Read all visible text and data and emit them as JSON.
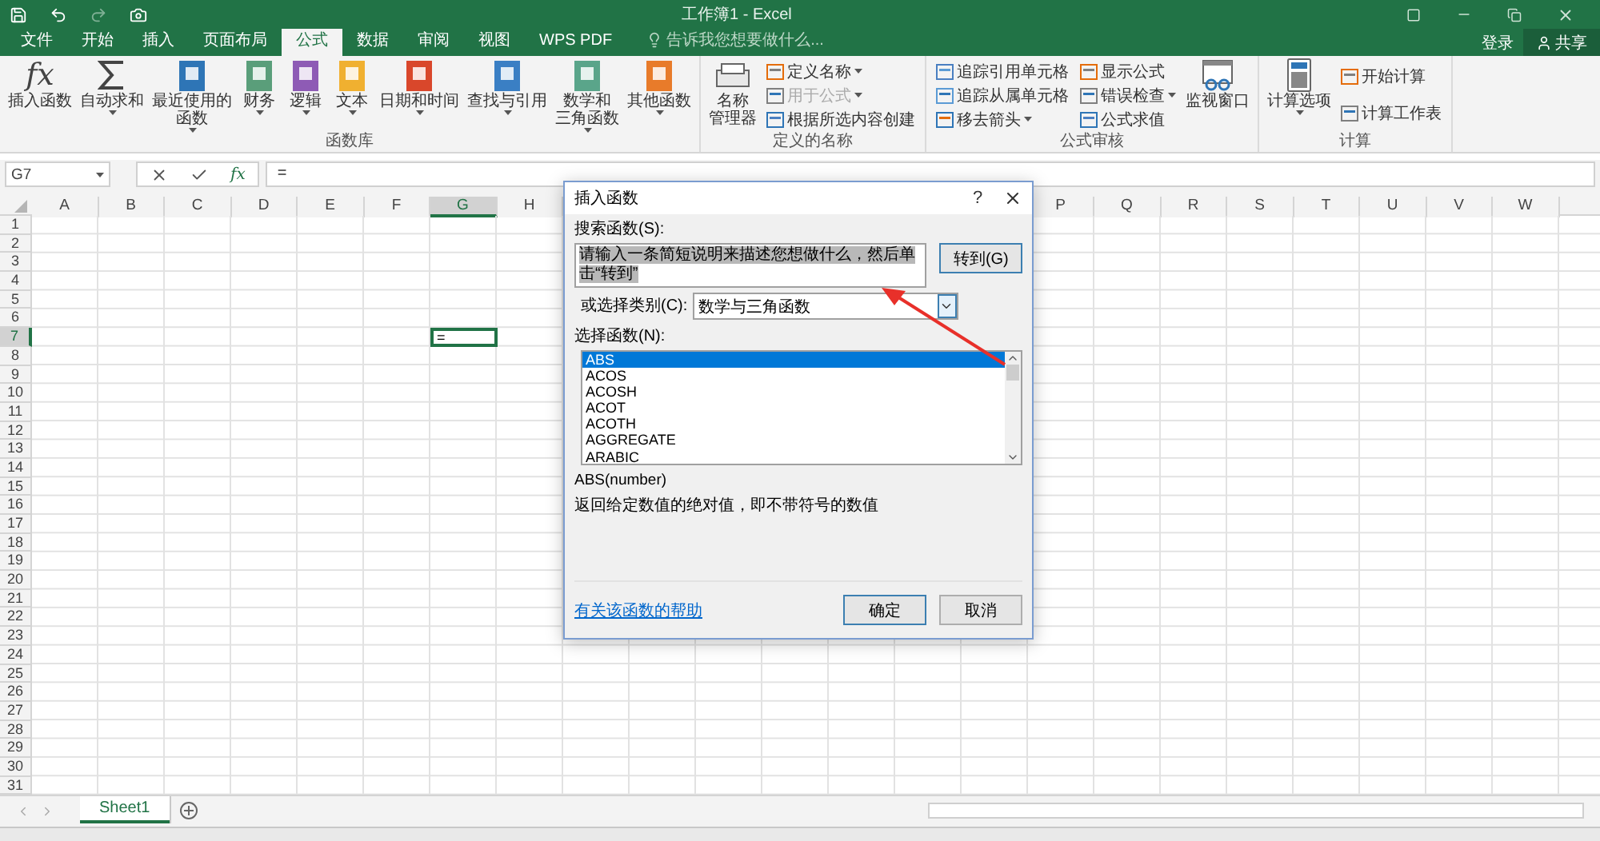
{
  "window": {
    "title": "工作簿1 - Excel"
  },
  "tabs": [
    {
      "label": "文件",
      "selected": false
    },
    {
      "label": "开始",
      "selected": false
    },
    {
      "label": "插入",
      "selected": false
    },
    {
      "label": "页面布局",
      "selected": false
    },
    {
      "label": "公式",
      "selected": true
    },
    {
      "label": "数据",
      "selected": false
    },
    {
      "label": "审阅",
      "selected": false
    },
    {
      "label": "视图",
      "selected": false
    },
    {
      "label": "WPS PDF",
      "selected": false
    }
  ],
  "tell_me": {
    "placeholder": "告诉我您想要做什么..."
  },
  "account": {
    "sign_in": "登录",
    "share": "共享"
  },
  "ribbon": {
    "groups": [
      {
        "label": "函数库",
        "items": [
          {
            "kind": "fx",
            "glyph": "fx",
            "label_lines": [
              "插入函数"
            ],
            "dropdown": false
          },
          {
            "kind": "sigma",
            "label_lines": [
              "自动求和"
            ],
            "dropdown": true
          },
          {
            "kind": "book",
            "color": "#2e75b6",
            "label_lines": [
              "最近使用的",
              "函数"
            ],
            "dropdown": true
          },
          {
            "kind": "book",
            "color": "#5a9e7a",
            "label_lines": [
              "财务"
            ],
            "dropdown": true
          },
          {
            "kind": "book",
            "color": "#8e5bb5",
            "label_lines": [
              "逻辑"
            ],
            "dropdown": true
          },
          {
            "kind": "book",
            "color": "#f0b030",
            "label_lines": [
              "文本"
            ],
            "dropdown": true
          },
          {
            "kind": "book",
            "color": "#d9472b",
            "label_lines": [
              "日期和时间"
            ],
            "dropdown": true
          },
          {
            "kind": "book",
            "color": "#3a7fc4",
            "label_lines": [
              "查找与引用"
            ],
            "dropdown": true
          },
          {
            "kind": "book",
            "color": "#5aa58a",
            "label_lines": [
              "数学和",
              "三角函数"
            ],
            "dropdown": true
          },
          {
            "kind": "book",
            "color": "#e87b2a",
            "label_lines": [
              "其他函数"
            ],
            "dropdown": true
          }
        ]
      },
      {
        "label": "定义的名称",
        "items": [
          {
            "kind": "names",
            "label_lines": [
              "名称",
              "管理器"
            ],
            "dropdown": false
          },
          {
            "kind": "small_stack",
            "rows": [
              {
                "label": "定义名称",
                "dropdown": true,
                "disabled": false
              },
              {
                "label": "用于公式",
                "dropdown": true,
                "disabled": true
              },
              {
                "label": "根据所选内容创建",
                "dropdown": false,
                "disabled": false
              }
            ]
          }
        ]
      },
      {
        "label": "公式审核",
        "items": [
          {
            "kind": "small_stack",
            "rows": [
              {
                "label": "追踪引用单元格",
                "dropdown": false,
                "disabled": false
              },
              {
                "label": "追踪从属单元格",
                "dropdown": false,
                "disabled": false
              },
              {
                "label": "移去箭头",
                "dropdown": true,
                "disabled": false
              }
            ]
          },
          {
            "kind": "small_stack",
            "rows": [
              {
                "label": "显示公式",
                "dropdown": false,
                "disabled": false
              },
              {
                "label": "错误检查",
                "dropdown": true,
                "disabled": false
              },
              {
                "label": "公式求值",
                "dropdown": false,
                "disabled": false
              }
            ]
          },
          {
            "kind": "watch",
            "label_lines": [
              "监视窗口"
            ],
            "dropdown": false
          }
        ]
      },
      {
        "label": "计算",
        "items": [
          {
            "kind": "calc",
            "label_lines": [
              "计算选项"
            ],
            "dropdown": true
          },
          {
            "kind": "small_stack",
            "rows": [
              {
                "label": "开始计算",
                "dropdown": false,
                "disabled": false
              },
              {
                "label": "计算工作表",
                "dropdown": false,
                "disabled": false
              }
            ]
          }
        ]
      }
    ]
  },
  "formula_bar": {
    "name_box": "G7",
    "fx": "fx",
    "value": "="
  },
  "grid": {
    "columns_left": [
      {
        "label": "A",
        "selected": false
      },
      {
        "label": "B",
        "selected": false
      },
      {
        "label": "C",
        "selected": false
      },
      {
        "label": "D",
        "selected": false
      },
      {
        "label": "E",
        "selected": false
      },
      {
        "label": "F",
        "selected": false
      },
      {
        "label": "G",
        "selected": true
      },
      {
        "label": "H",
        "selected": false
      }
    ],
    "columns_right": [
      {
        "label": "P",
        "selected": false
      },
      {
        "label": "Q",
        "selected": false
      },
      {
        "label": "R",
        "selected": false
      },
      {
        "label": "S",
        "selected": false
      },
      {
        "label": "T",
        "selected": false
      },
      {
        "label": "U",
        "selected": false
      },
      {
        "label": "V",
        "selected": false
      },
      {
        "label": "W",
        "selected": false
      }
    ],
    "rows": [
      {
        "label": "1",
        "selected": false
      },
      {
        "label": "2",
        "selected": false
      },
      {
        "label": "3",
        "selected": false
      },
      {
        "label": "4",
        "selected": false
      },
      {
        "label": "5",
        "selected": false
      },
      {
        "label": "6",
        "selected": false
      },
      {
        "label": "7",
        "selected": true
      },
      {
        "label": "8",
        "selected": false
      },
      {
        "label": "9",
        "selected": false
      },
      {
        "label": "10",
        "selected": false
      },
      {
        "label": "11",
        "selected": false
      },
      {
        "label": "12",
        "selected": false
      },
      {
        "label": "13",
        "selected": false
      },
      {
        "label": "14",
        "selected": false
      },
      {
        "label": "15",
        "selected": false
      },
      {
        "label": "16",
        "selected": false
      },
      {
        "label": "17",
        "selected": false
      },
      {
        "label": "18",
        "selected": false
      },
      {
        "label": "19",
        "selected": false
      },
      {
        "label": "20",
        "selected": false
      },
      {
        "label": "21",
        "selected": false
      },
      {
        "label": "22",
        "selected": false
      },
      {
        "label": "23",
        "selected": false
      },
      {
        "label": "24",
        "selected": false
      },
      {
        "label": "25",
        "selected": false
      },
      {
        "label": "26",
        "selected": false
      },
      {
        "label": "27",
        "selected": false
      },
      {
        "label": "28",
        "selected": false
      },
      {
        "label": "29",
        "selected": false
      },
      {
        "label": "30",
        "selected": false
      },
      {
        "label": "31",
        "selected": false
      }
    ],
    "active_cell_value": "="
  },
  "sheets": [
    {
      "label": "Sheet1",
      "selected": true
    }
  ],
  "dialog": {
    "title": "插入函数",
    "help": "?",
    "search_label": "搜索函数(S):",
    "search_value": "请输入一条简短说明来描述您想做什么，然后单击“转到”",
    "go_button": "转到(G)",
    "category_label": "或选择类别(C):",
    "category_value": "数学与三角函数",
    "list_label": "选择函数(N):",
    "functions": [
      {
        "label": "ABS",
        "selected": true
      },
      {
        "label": "ACOS",
        "selected": false
      },
      {
        "label": "ACOSH",
        "selected": false
      },
      {
        "label": "ACOT",
        "selected": false
      },
      {
        "label": "ACOTH",
        "selected": false
      },
      {
        "label": "AGGREGATE",
        "selected": false
      },
      {
        "label": "ARABIC",
        "selected": false
      }
    ],
    "signature": "ABS(number)",
    "description": "返回给定数值的绝对值，即不带符号的数值",
    "help_link": "有关该函数的帮助",
    "ok": "确定",
    "cancel": "取消"
  }
}
